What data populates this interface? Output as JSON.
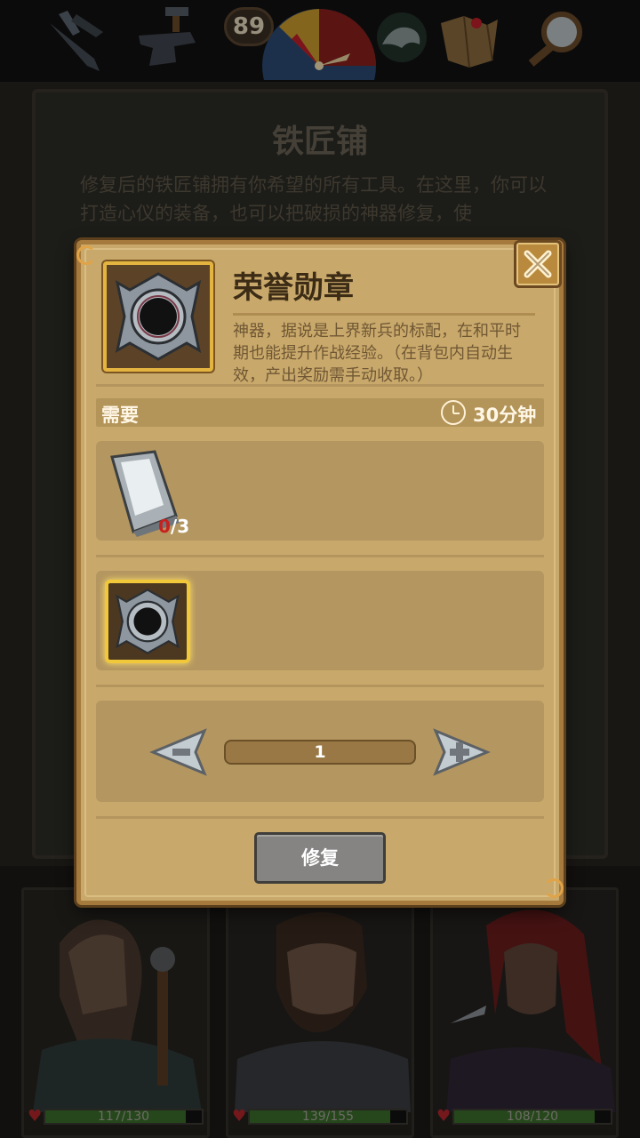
{
  "topbar": {
    "level": "89",
    "icons": [
      "crossed-swords-icon",
      "anvil-icon",
      "compass-icon",
      "dragon-icon",
      "map-icon",
      "magnifier-icon"
    ]
  },
  "background_panel": {
    "title": "铁匠铺",
    "description": "修复后的铁匠铺拥有你希望的所有工具。在这里，你可以打造心仪的装备，也可以把破损的神器修复，使"
  },
  "modal": {
    "item_name": "荣誉勋章",
    "item_icon": "medal-icon",
    "item_description": "神器，据说是上界新兵的标配，在和平时期也能提升作战经验。（在背包内自动生效，产出奖励需手动收取。）",
    "requirement_label": "需要",
    "time_label": "30分钟",
    "material": {
      "icon": "iron-ingot-icon",
      "have": "0",
      "need": "/3"
    },
    "result_icon": "medal-icon",
    "quantity": "1",
    "repair_label": "修复"
  },
  "heroes": [
    {
      "name": "hero-1",
      "hp_text": "117/130",
      "hp_fraction": 0.9
    },
    {
      "name": "hero-2",
      "hp_text": "139/155",
      "hp_fraction": 0.8968
    },
    {
      "name": "hero-3",
      "hp_text": "108/120",
      "hp_fraction": 0.9
    }
  ],
  "colors": {
    "parchment": "#c9a96b",
    "frame_gold": "#e3b43f",
    "hp_green": "#3a6d2a",
    "heart_red": "#b3262c"
  }
}
